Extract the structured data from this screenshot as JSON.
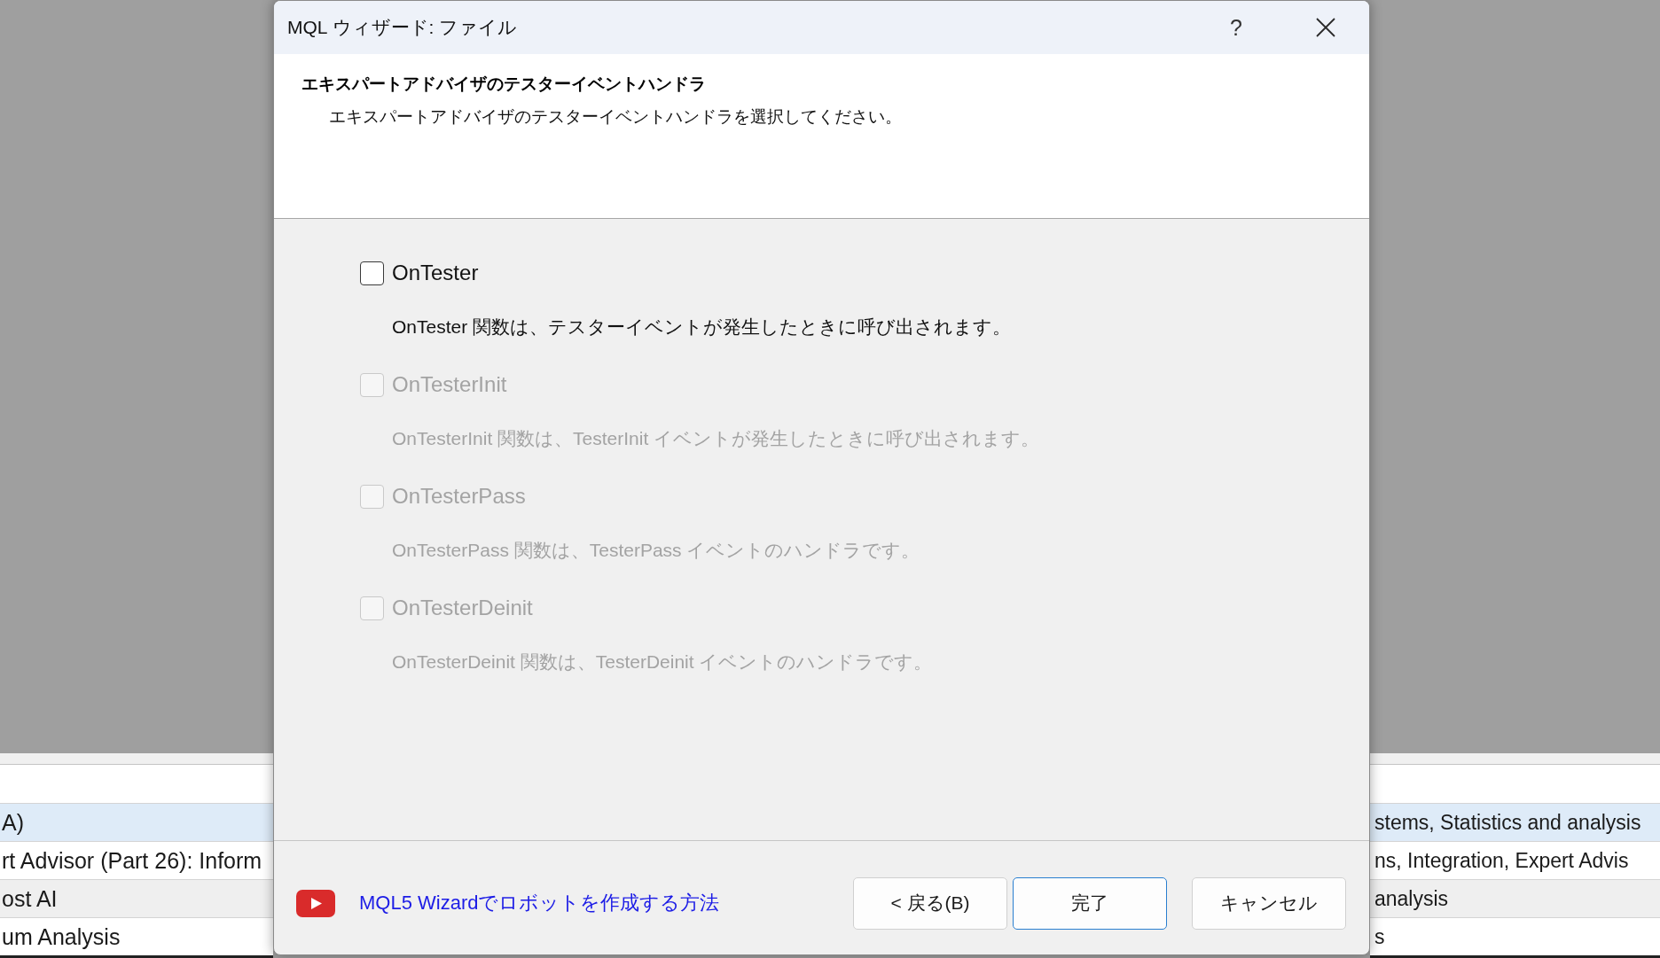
{
  "background_list": {
    "rows": [
      {
        "left_text": "A)",
        "right_text": "stems, Statistics and analysis",
        "selected": true
      },
      {
        "left_text": "rt Advisor (Part 26): Inform",
        "right_text": "ns, Integration, Expert Advis",
        "selected": false
      },
      {
        "left_text": "ost AI",
        "right_text": "analysis",
        "selected": false
      },
      {
        "left_text": "um Analysis",
        "right_text": "s",
        "selected": false
      }
    ]
  },
  "dialog": {
    "title": "MQL ウィザード: ファイル",
    "help": "?",
    "heading": "エキスパートアドバイザのテスターイベントハンドラ",
    "subheading": "エキスパートアドバイザのテスターイベントハンドラを選択してください。",
    "handlers": [
      {
        "label": "OnTester",
        "description": "OnTester 関数は、テスターイベントが発生したときに呼び出されます。",
        "checked": false,
        "disabled": false
      },
      {
        "label": "OnTesterInit",
        "description": "OnTesterInit 関数は、TesterInit イベントが発生したときに呼び出されます。",
        "checked": false,
        "disabled": true
      },
      {
        "label": "OnTesterPass",
        "description": "OnTesterPass 関数は、TesterPass イベントのハンドラです。",
        "checked": false,
        "disabled": true
      },
      {
        "label": "OnTesterDeinit",
        "description": "OnTesterDeinit 関数は、TesterDeinit イベントのハンドラです。",
        "checked": false,
        "disabled": true
      }
    ],
    "video_link": "MQL5 Wizardでロボットを作成する方法",
    "buttons": [
      {
        "label": "< 戻る(B)",
        "default": false
      },
      {
        "label": "完了",
        "default": true
      },
      {
        "label": "キャンセル",
        "default": false
      }
    ]
  }
}
